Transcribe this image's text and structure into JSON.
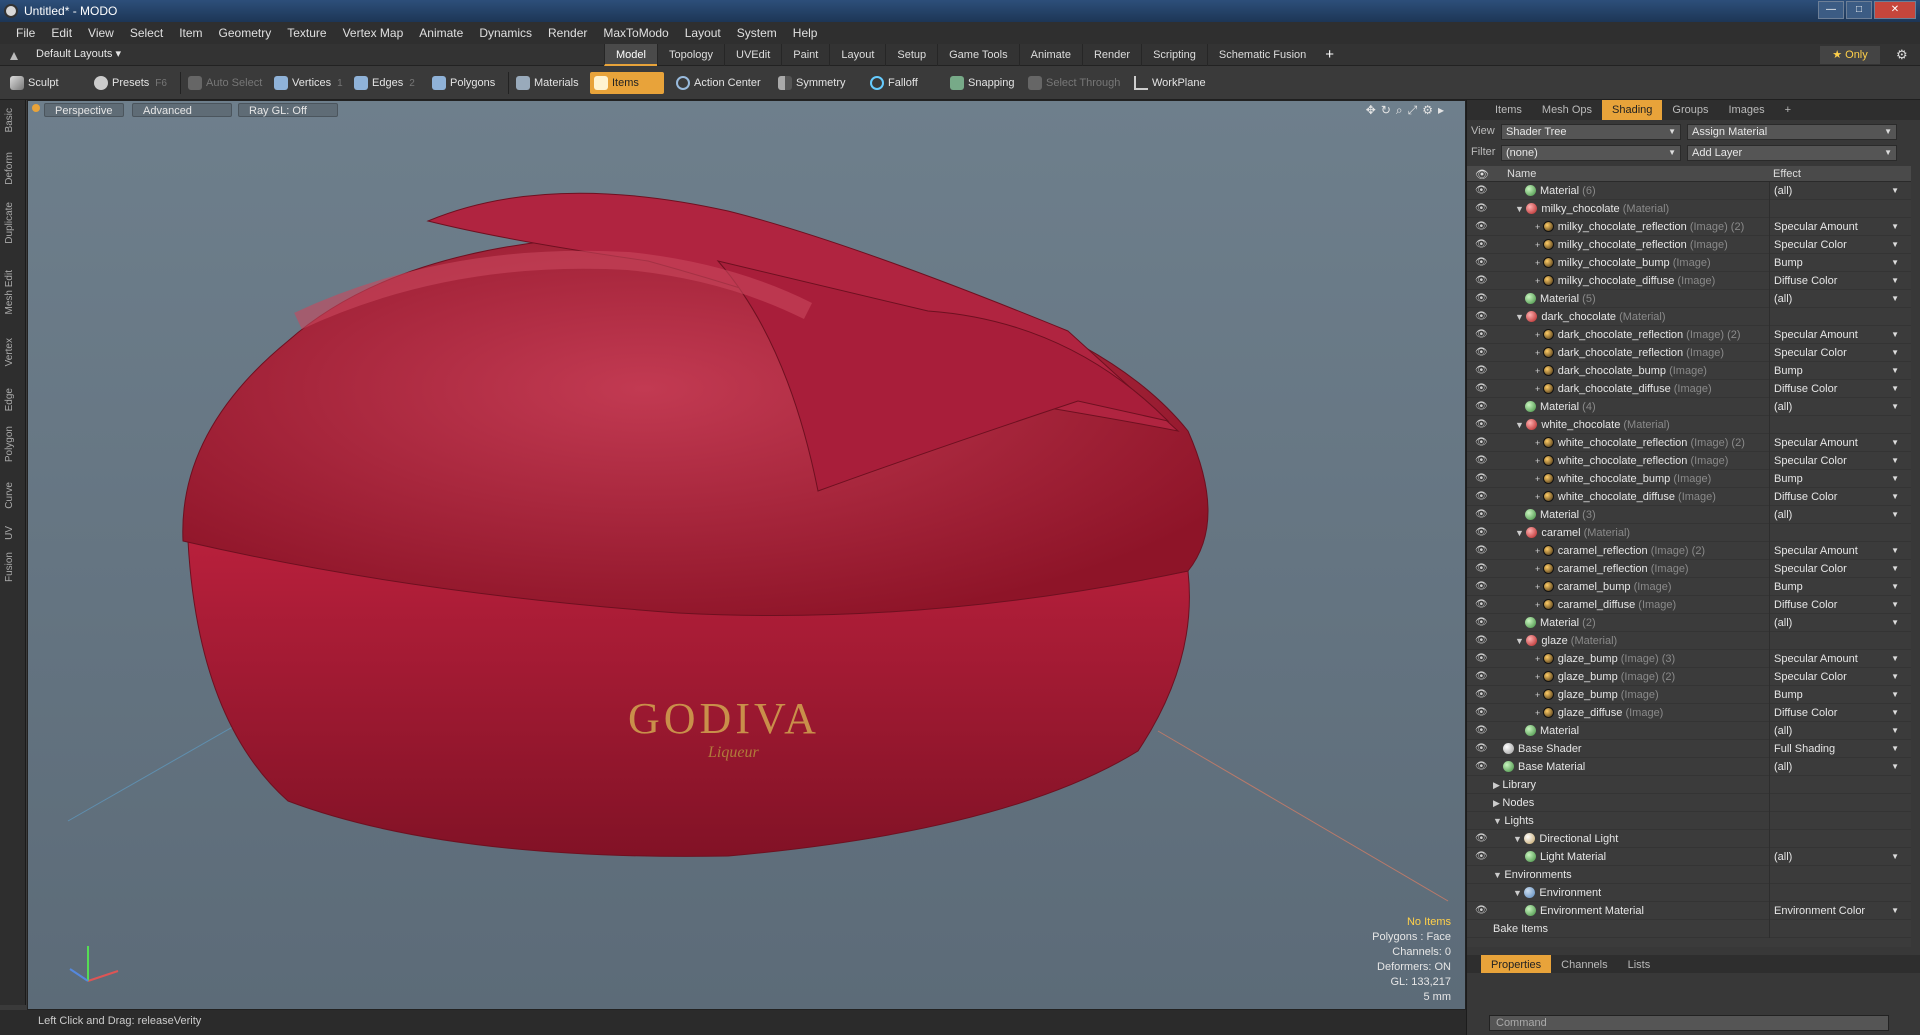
{
  "window": {
    "title": "Untitled* - MODO",
    "minimize": "—",
    "maximize": "□",
    "close": "✕"
  },
  "menu": [
    "File",
    "Edit",
    "View",
    "Select",
    "Item",
    "Geometry",
    "Texture",
    "Vertex Map",
    "Animate",
    "Dynamics",
    "Render",
    "MaxToModo",
    "Layout",
    "System",
    "Help"
  ],
  "tabs": {
    "layouts": "Default Layouts ▾",
    "items": [
      "Model",
      "Topology",
      "UVEdit",
      "Paint",
      "Layout",
      "Setup",
      "Game Tools",
      "Animate",
      "Render",
      "Scripting",
      "Schematic Fusion"
    ],
    "active": "Model",
    "plus": "+",
    "only": "★  Only"
  },
  "toolbar": {
    "sculpt": "Sculpt",
    "presets": "Presets",
    "presets_key": "F6",
    "auto_select": "Auto Select",
    "vertices": "Vertices",
    "vertices_key": "1",
    "edges": "Edges",
    "edges_key": "2",
    "polygons": "Polygons",
    "materials": "Materials",
    "items": "Items",
    "action_center": "Action Center",
    "symmetry": "Symmetry",
    "falloff": "Falloff",
    "snapping": "Snapping",
    "select_through": "Select Through",
    "workplane": "WorkPlane"
  },
  "left_strip": [
    "Basic",
    "Deform",
    "Duplicate",
    "Mesh Edit",
    "Vertex",
    "Edge",
    "Polygon",
    "Curve",
    "UV",
    "Fusion"
  ],
  "viewport": {
    "perspective": "Perspective",
    "advanced": "Advanced",
    "raygl": "Ray GL: Off",
    "brand": "GODIVA",
    "sub": "Liqueur",
    "hud": {
      "noitems": "No Items",
      "polygons": "Polygons : Face",
      "channels": "Channels: 0",
      "deformers": "Deformers: ON",
      "gl": "GL: 133,217",
      "units": "5 mm"
    }
  },
  "status": {
    "text": "Left Click and Drag:   releaseVerity"
  },
  "panel": {
    "tabs": [
      "Items",
      "Mesh Ops",
      "Shading",
      "Groups",
      "Images"
    ],
    "active": "Shading",
    "plus": "+",
    "view_label": "View",
    "view_value": "Shader Tree",
    "assign": "Assign Material",
    "filter_label": "Filter",
    "filter_value": "(none)",
    "add_layer": "Add Layer",
    "col_name": "Name",
    "col_effect": "Effect",
    "rows": [
      {
        "indent": 72,
        "ball": "green",
        "name": "Material",
        "type": " (6)",
        "effect": "(all)",
        "eye": true
      },
      {
        "indent": 62,
        "ball": "red",
        "name": "milky_chocolate",
        "type": " (Material)",
        "effect": "",
        "eye": true,
        "exp": "▼"
      },
      {
        "indent": 82,
        "ball": "tex",
        "name": "milky_chocolate_reflection",
        "type": " (Image) (2)",
        "effect": "Specular Amount",
        "eye": true,
        "plus": true
      },
      {
        "indent": 82,
        "ball": "tex",
        "name": "milky_chocolate_reflection",
        "type": " (Image)",
        "effect": "Specular Color",
        "eye": true,
        "plus": true
      },
      {
        "indent": 82,
        "ball": "tex",
        "name": "milky_chocolate_bump",
        "type": " (Image)",
        "effect": "Bump",
        "eye": true,
        "plus": true
      },
      {
        "indent": 82,
        "ball": "tex",
        "name": "milky_chocolate_diffuse",
        "type": " (Image)",
        "effect": "Diffuse Color",
        "eye": true,
        "plus": true
      },
      {
        "indent": 72,
        "ball": "green",
        "name": "Material",
        "type": " (5)",
        "effect": "(all)",
        "eye": true
      },
      {
        "indent": 62,
        "ball": "red",
        "name": "dark_chocolate",
        "type": " (Material)",
        "effect": "",
        "eye": true,
        "exp": "▼"
      },
      {
        "indent": 82,
        "ball": "tex",
        "name": "dark_chocolate_reflection",
        "type": " (Image) (2)",
        "effect": "Specular Amount",
        "eye": true,
        "plus": true
      },
      {
        "indent": 82,
        "ball": "tex",
        "name": "dark_chocolate_reflection",
        "type": " (Image)",
        "effect": "Specular Color",
        "eye": true,
        "plus": true
      },
      {
        "indent": 82,
        "ball": "tex",
        "name": "dark_chocolate_bump",
        "type": " (Image)",
        "effect": "Bump",
        "eye": true,
        "plus": true
      },
      {
        "indent": 82,
        "ball": "tex",
        "name": "dark_chocolate_diffuse",
        "type": " (Image)",
        "effect": "Diffuse Color",
        "eye": true,
        "plus": true
      },
      {
        "indent": 72,
        "ball": "green",
        "name": "Material",
        "type": " (4)",
        "effect": "(all)",
        "eye": true
      },
      {
        "indent": 62,
        "ball": "red",
        "name": "white_chocolate",
        "type": " (Material)",
        "effect": "",
        "eye": true,
        "exp": "▼"
      },
      {
        "indent": 82,
        "ball": "tex",
        "name": "white_chocolate_reflection",
        "type": " (Image) (2)",
        "effect": "Specular Amount",
        "eye": true,
        "plus": true
      },
      {
        "indent": 82,
        "ball": "tex",
        "name": "white_chocolate_reflection",
        "type": " (Image)",
        "effect": "Specular Color",
        "eye": true,
        "plus": true
      },
      {
        "indent": 82,
        "ball": "tex",
        "name": "white_chocolate_bump",
        "type": " (Image)",
        "effect": "Bump",
        "eye": true,
        "plus": true
      },
      {
        "indent": 82,
        "ball": "tex",
        "name": "white_chocolate_diffuse",
        "type": " (Image)",
        "effect": "Diffuse Color",
        "eye": true,
        "plus": true
      },
      {
        "indent": 72,
        "ball": "green",
        "name": "Material",
        "type": " (3)",
        "effect": "(all)",
        "eye": true
      },
      {
        "indent": 62,
        "ball": "red",
        "name": "caramel",
        "type": " (Material)",
        "effect": "",
        "eye": true,
        "exp": "▼"
      },
      {
        "indent": 82,
        "ball": "tex",
        "name": "caramel_reflection",
        "type": " (Image) (2)",
        "effect": "Specular Amount",
        "eye": true,
        "plus": true
      },
      {
        "indent": 82,
        "ball": "tex",
        "name": "caramel_reflection",
        "type": " (Image)",
        "effect": "Specular Color",
        "eye": true,
        "plus": true
      },
      {
        "indent": 82,
        "ball": "tex",
        "name": "caramel_bump",
        "type": " (Image)",
        "effect": "Bump",
        "eye": true,
        "plus": true
      },
      {
        "indent": 82,
        "ball": "tex",
        "name": "caramel_diffuse",
        "type": " (Image)",
        "effect": "Diffuse Color",
        "eye": true,
        "plus": true
      },
      {
        "indent": 72,
        "ball": "green",
        "name": "Material",
        "type": " (2)",
        "effect": "(all)",
        "eye": true
      },
      {
        "indent": 62,
        "ball": "red",
        "name": "glaze",
        "type": " (Material)",
        "effect": "",
        "eye": true,
        "exp": "▼"
      },
      {
        "indent": 82,
        "ball": "tex",
        "name": "glaze_bump",
        "type": " (Image) (3)",
        "effect": "Specular Amount",
        "eye": true,
        "plus": true
      },
      {
        "indent": 82,
        "ball": "tex",
        "name": "glaze_bump",
        "type": " (Image) (2)",
        "effect": "Specular Color",
        "eye": true,
        "plus": true
      },
      {
        "indent": 82,
        "ball": "tex",
        "name": "glaze_bump",
        "type": " (Image)",
        "effect": "Bump",
        "eye": true,
        "plus": true
      },
      {
        "indent": 82,
        "ball": "tex",
        "name": "glaze_diffuse",
        "type": " (Image)",
        "effect": "Diffuse Color",
        "eye": true,
        "plus": true
      },
      {
        "indent": 72,
        "ball": "green",
        "name": "Material",
        "type": "",
        "effect": "(all)",
        "eye": true
      },
      {
        "indent": 50,
        "ball": "white",
        "name": "Base Shader",
        "type": "",
        "effect": "Full Shading",
        "eye": true
      },
      {
        "indent": 50,
        "ball": "green",
        "name": "Base Material",
        "type": "",
        "effect": "(all)",
        "eye": true
      },
      {
        "indent": 40,
        "ball": "",
        "name": "Library",
        "type": "",
        "effect": "",
        "eye": false,
        "exp": "▶"
      },
      {
        "indent": 40,
        "ball": "",
        "name": "Nodes",
        "type": "",
        "effect": "",
        "eye": false,
        "exp": "▶"
      },
      {
        "indent": 40,
        "ball": "",
        "name": "Lights",
        "type": "",
        "effect": "",
        "eye": false,
        "exp": "▼"
      },
      {
        "indent": 60,
        "ball": "light",
        "name": "Directional Light",
        "type": "",
        "effect": "",
        "eye": true,
        "exp": "▼"
      },
      {
        "indent": 72,
        "ball": "green",
        "name": "Light Material",
        "type": "",
        "effect": "(all)",
        "eye": true
      },
      {
        "indent": 40,
        "ball": "",
        "name": "Environments",
        "type": "",
        "effect": "",
        "eye": false,
        "exp": "▼"
      },
      {
        "indent": 60,
        "ball": "env",
        "name": "Environment",
        "type": "",
        "effect": "",
        "eye": false,
        "exp": "▼"
      },
      {
        "indent": 72,
        "ball": "green",
        "name": "Environment Material",
        "type": "",
        "effect": "Environment Color",
        "eye": true
      },
      {
        "indent": 40,
        "ball": "",
        "name": "Bake Items",
        "type": "",
        "effect": "",
        "eye": false
      }
    ],
    "bottom_tabs": [
      "Properties",
      "Channels",
      "Lists"
    ],
    "bottom_active": "Properties",
    "command": "Command"
  }
}
